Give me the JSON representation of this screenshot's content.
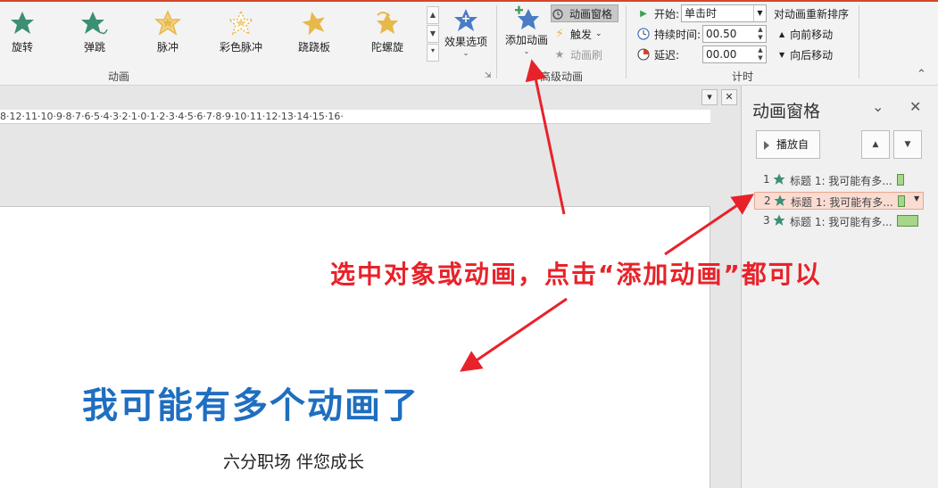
{
  "ribbon": {
    "animations": [
      {
        "label": "旋转",
        "icon": "spin-star-icon",
        "color": "#3c8f74"
      },
      {
        "label": "弹跳",
        "icon": "bounce-star-icon",
        "color": "#3c8f74"
      },
      {
        "label": "脉冲",
        "icon": "pulse-star-icon",
        "color": "#e7b84a"
      },
      {
        "label": "彩色脉冲",
        "icon": "color-pulse-star-icon",
        "color": "#e7b84a"
      },
      {
        "label": "跷跷板",
        "icon": "teeter-star-icon",
        "color": "#e7b84a"
      },
      {
        "label": "陀螺旋",
        "icon": "spinner-star-icon",
        "color": "#e7b84a"
      }
    ],
    "effect_options_label": "效果选项",
    "animation_group_label": "动画",
    "add_animation_label": "添加动画",
    "animation_pane_label": "动画窗格",
    "trigger_label": "触发",
    "animation_painter_label": "动画刷",
    "advanced_group_label": "高级动画",
    "start_label": "开始:",
    "start_value": "单击时",
    "duration_label": "持续时间:",
    "duration_value": "00.50",
    "delay_label": "延迟:",
    "delay_value": "00.00",
    "reorder_label": "对动画重新排序",
    "move_earlier_label": "向前移动",
    "move_later_label": "向后移动",
    "timing_group_label": "计时"
  },
  "editor": {
    "ruler_text": "8·12·11·10·9·8·7·6·5·4·3·2·1·0·1·2·3·4·5·6·7·8·9·10·11·12·13·14·15·16·",
    "slide_title": "我可能有多个动画了",
    "slide_subtitle": "六分职场 伴您成长"
  },
  "pane": {
    "title": "动画窗格",
    "play_label": "播放自",
    "items": [
      {
        "number": "1",
        "text": "标题 1: 我可能有多...",
        "selected": false,
        "bar_fraction": 0.25
      },
      {
        "number": "2",
        "text": "标题 1: 我可能有多...",
        "selected": true,
        "bar_fraction": 0.25
      },
      {
        "number": "3",
        "text": "标题 1: 我可能有多...",
        "selected": false,
        "bar_fraction": 1.0
      }
    ]
  },
  "annotation": {
    "text": "选中对象或动画，点击“添加动画”都可以",
    "color": "#e8222a"
  },
  "colors": {
    "accent_blue": "#1f6ec0",
    "selection_fill": "#fadcd2",
    "timeline_bar": "#a6d68a"
  }
}
